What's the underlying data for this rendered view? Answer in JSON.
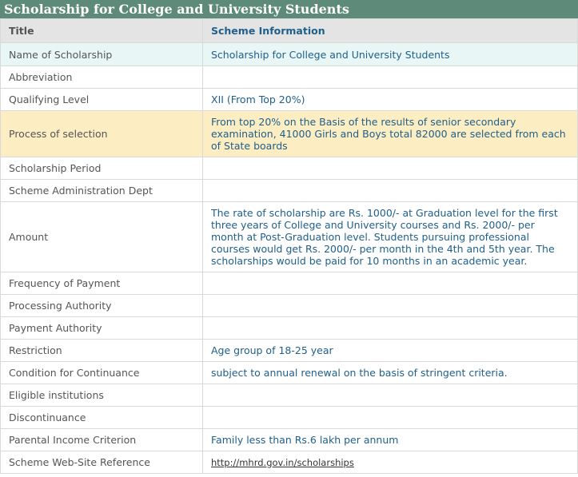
{
  "page_title": "Scholarship for College and University Students",
  "headers": {
    "title": "Title",
    "info": "Scheme Information"
  },
  "rows": [
    {
      "label": "Name of Scholarship",
      "value": "Scholarship for College and University Students"
    },
    {
      "label": "Abbreviation",
      "value": ""
    },
    {
      "label": "Qualifying Level",
      "value": "XII (From Top 20%)"
    },
    {
      "label": "Process of selection",
      "value": "From top 20% on the Basis of the results of senior secondary examination, 41000 Girls and Boys total 82000 are selected from each of State boards"
    },
    {
      "label": "Scholarship Period",
      "value": ""
    },
    {
      "label": "Scheme Administration Dept",
      "value": ""
    },
    {
      "label": "Amount",
      "value": "The rate of scholarship are Rs. 1000/- at Graduation level for the first three years of College and University courses and Rs. 2000/- per month at Post-Graduation level. Students pursuing professional courses would get Rs. 2000/- per month in the 4th and 5th year. The scholarships would be paid for 10 months in an academic year."
    },
    {
      "label": "Frequency of Payment",
      "value": ""
    },
    {
      "label": "Processing Authority",
      "value": ""
    },
    {
      "label": "Payment Authority",
      "value": ""
    },
    {
      "label": "Restriction",
      "value": "Age group of 18-25 year"
    },
    {
      "label": "Condition for Continuance",
      "value": "subject to annual renewal on the basis of stringent criteria."
    },
    {
      "label": "Eligible institutions",
      "value": ""
    },
    {
      "label": "Discontinuance",
      "value": ""
    },
    {
      "label": "Parental Income Criterion",
      "value": "Family less than Rs.6 lakh per annum"
    },
    {
      "label": "Scheme Web-Site Reference",
      "value": "http://mhrd.gov.in/scholarships"
    }
  ]
}
